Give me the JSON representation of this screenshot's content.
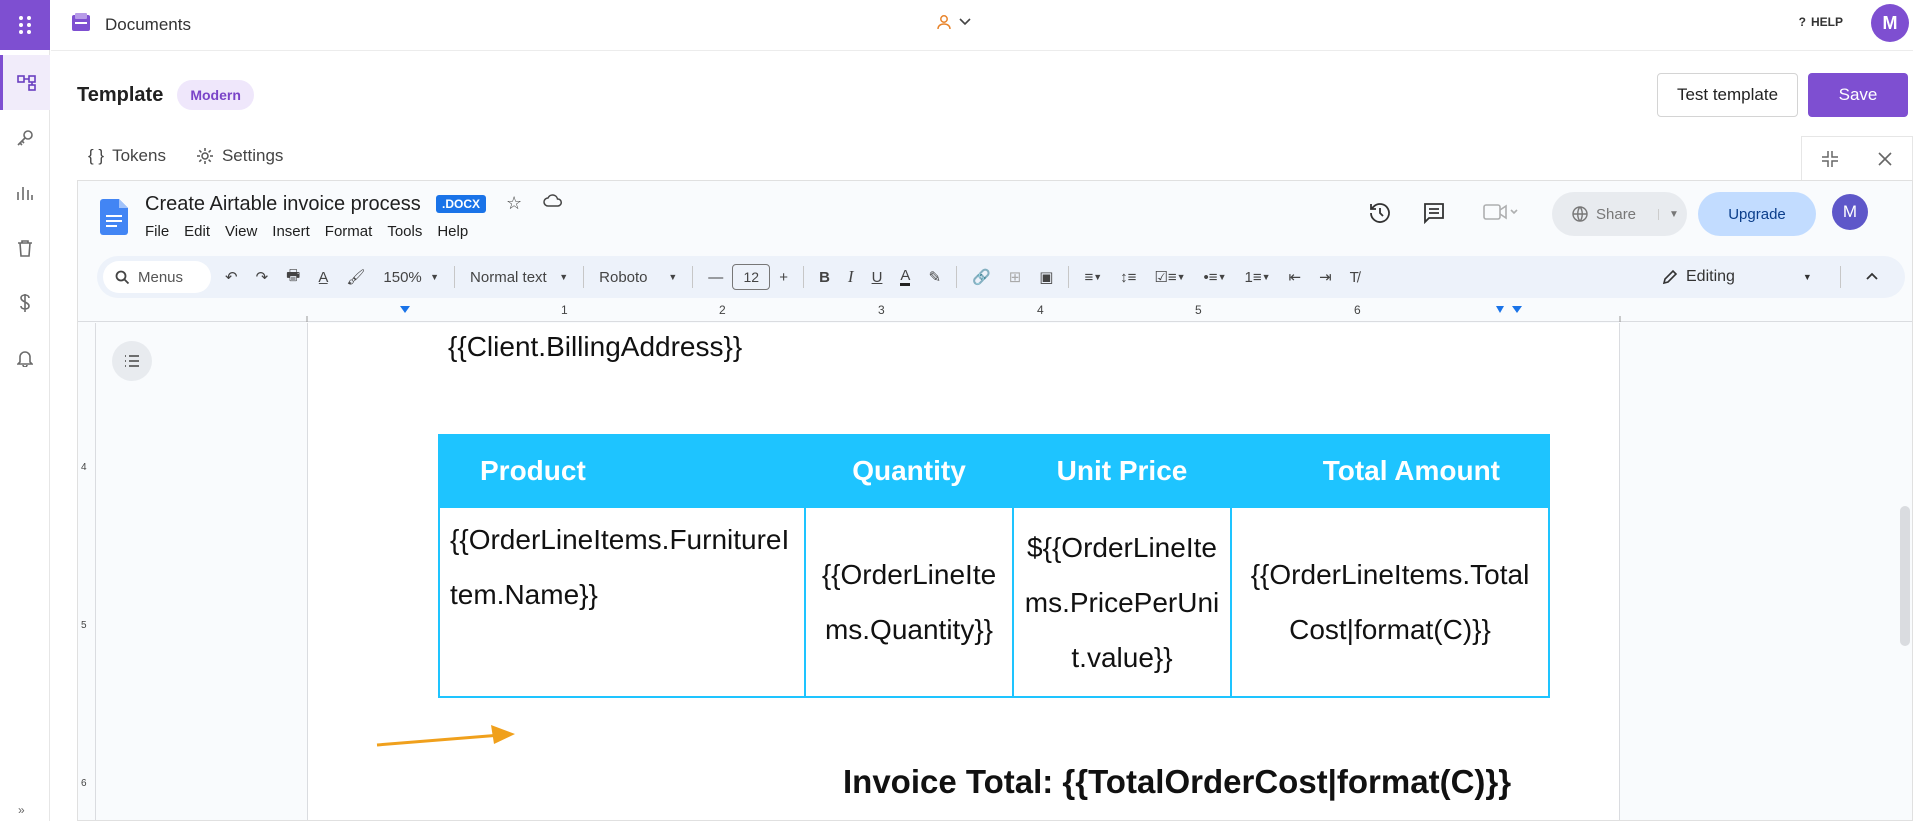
{
  "app": {
    "title": "Documents",
    "user_initial": "M",
    "help": "HELP"
  },
  "header": {
    "title": "Template",
    "badge": "Modern",
    "test_label": "Test template",
    "save_label": "Save"
  },
  "tabs": [
    {
      "label": "Tokens"
    },
    {
      "label": "Settings"
    }
  ],
  "gdoc": {
    "title": "Create Airtable invoice process",
    "badge": ".DOCX",
    "menus": [
      "File",
      "Edit",
      "View",
      "Insert",
      "Format",
      "Tools",
      "Help"
    ],
    "share_label": "Share",
    "upgrade_label": "Upgrade",
    "avatar": "M"
  },
  "toolbar": {
    "search_label": "Menus",
    "zoom": "150%",
    "style": "Normal text",
    "font": "Roboto",
    "font_size": "12",
    "mode": "Editing"
  },
  "ruler": {
    "marks": [
      "1",
      "2",
      "3",
      "4",
      "5",
      "6"
    ],
    "vmarks": [
      "4",
      "5",
      "6"
    ]
  },
  "document": {
    "address": "{{Client.BillingAddress}}",
    "table": {
      "headers": [
        "Product",
        "Quantity",
        "Unit Price",
        "Total Amount"
      ],
      "row": [
        "{{OrderLineItems.FurnitureItem.Name}}",
        "{{OrderLineItems.Quantity}}",
        "${{OrderLineItems.PricePerUnit.value}}",
        "{{OrderLineItems.TotalCost|format(C)}}"
      ]
    },
    "invoice_total": "Invoice Total: {{TotalOrderCost|format(C)}}"
  }
}
